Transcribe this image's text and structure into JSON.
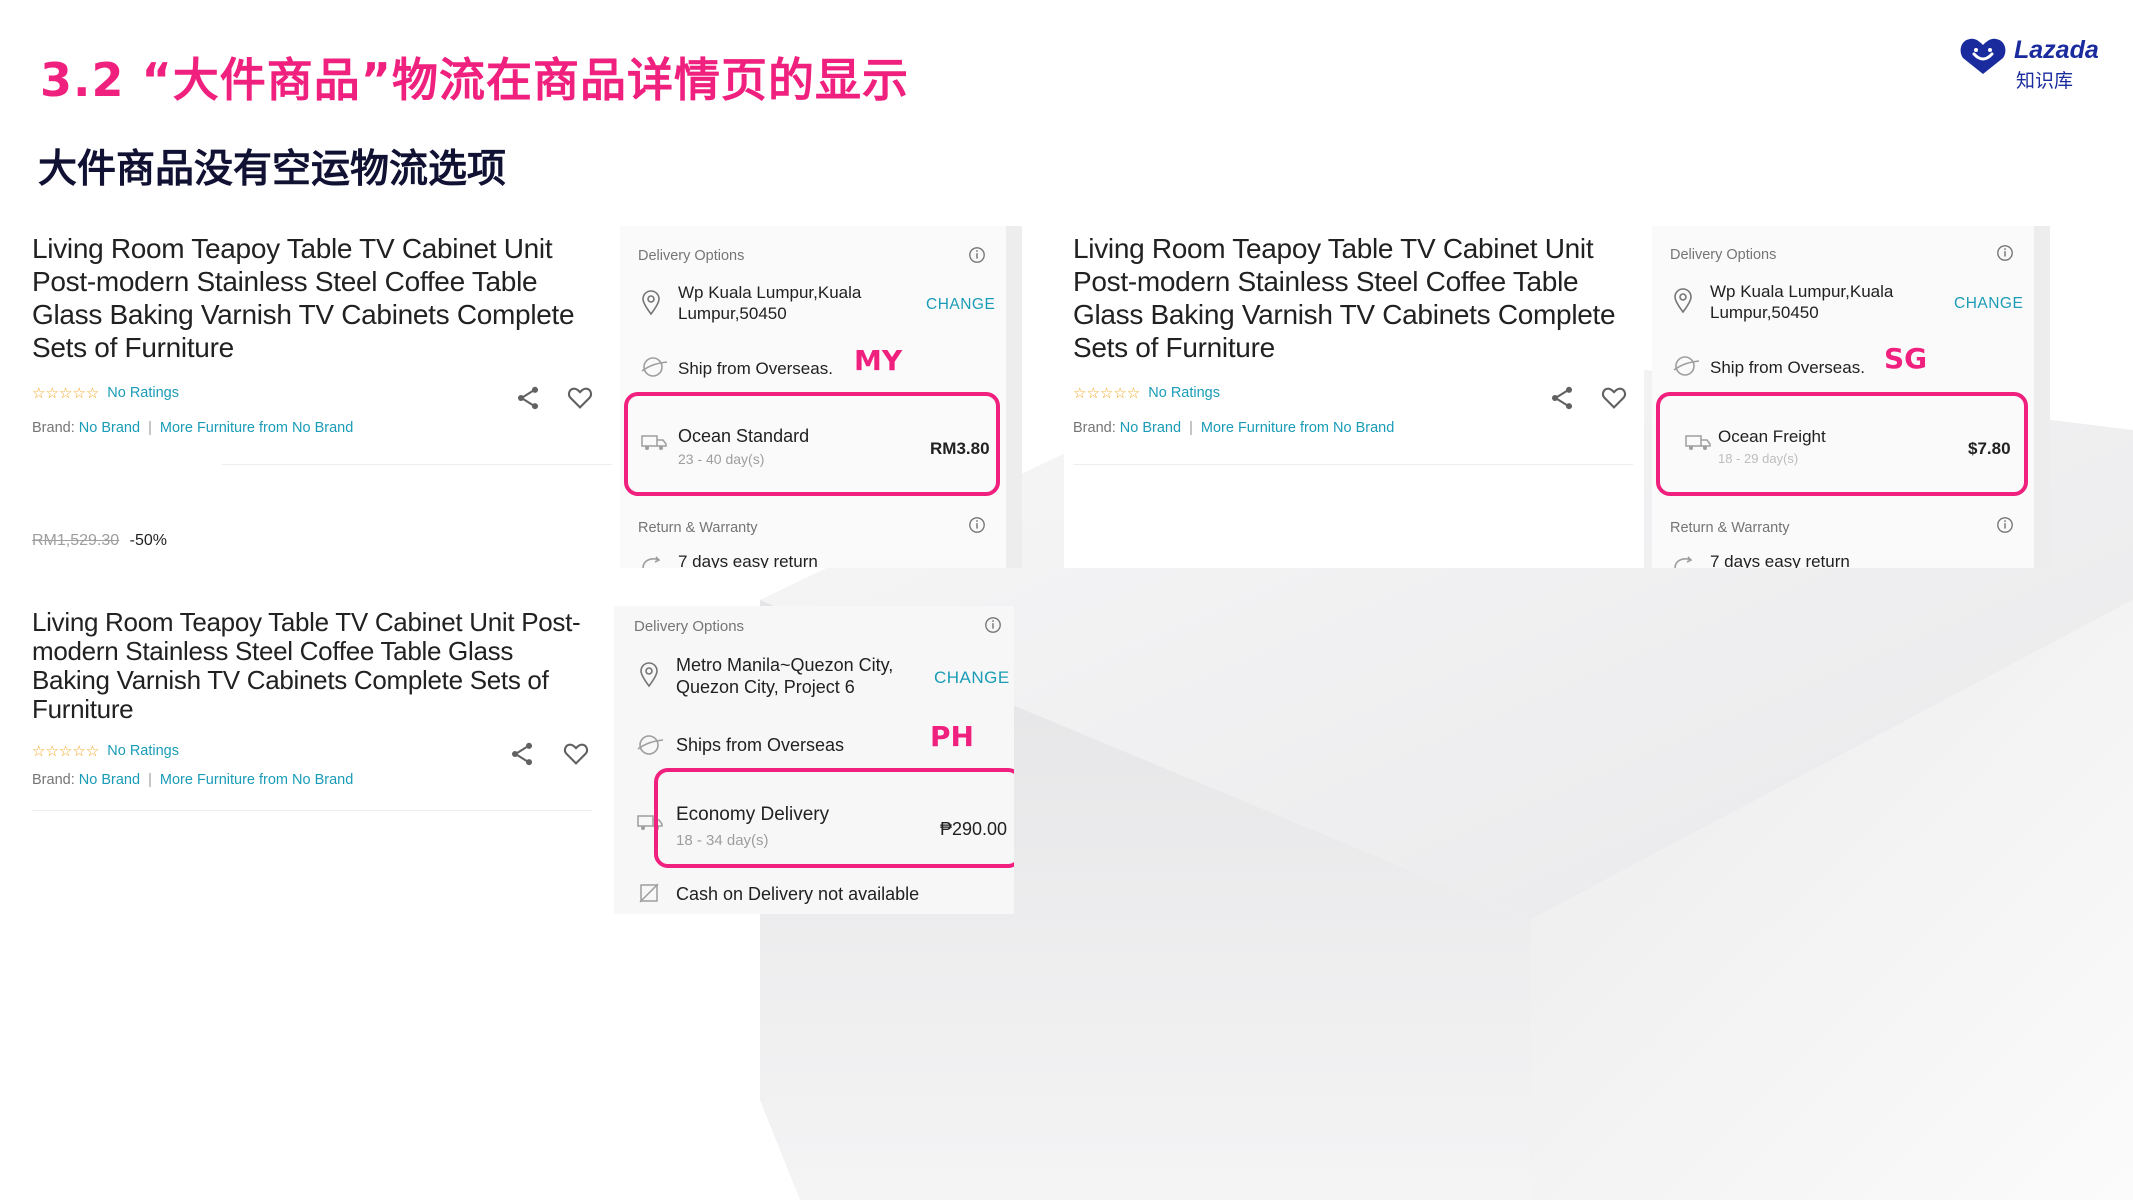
{
  "slide": {
    "title": "3.2 “大件商品”物流在商品详情页的显示",
    "subtitle": "大件商品没有空运物流选项"
  },
  "logo": {
    "wordmark": "Lazada",
    "sub": "知识库",
    "color": "#1a2b9e"
  },
  "accent_color": "#f0207e",
  "link_color": "#1a9cb7",
  "products": [
    {
      "title": "Living Room Teapoy Table TV Cabinet Unit Post-modern Stainless Steel Coffee Table Glass Baking Varnish TV Cabinets Complete Sets of Furniture",
      "stars": "☆☆☆☆☆",
      "no_ratings": "No Ratings",
      "brand_label": "Brand:",
      "brand": "No Brand",
      "sep": "|",
      "more": "More Furniture from No Brand",
      "old_price": "RM1,529.30",
      "discount": "-50%",
      "share_icon": "share-icon",
      "heart_icon": "heart-icon"
    },
    {
      "title": "Living Room Teapoy Table TV Cabinet Unit Post-modern Stainless Steel Coffee Table Glass Baking Varnish TV Cabinets Complete Sets of Furniture",
      "stars": "☆☆☆☆☆",
      "no_ratings": "No Ratings",
      "brand_label": "Brand:",
      "brand": "No Brand",
      "sep": "|",
      "more": "More Furniture from No Brand"
    },
    {
      "title": "Living Room Teapoy Table TV Cabinet Unit Post-modern Stainless Steel Coffee Table Glass Baking Varnish TV Cabinets Complete Sets of Furniture",
      "stars": "☆☆☆☆☆",
      "no_ratings": "No Ratings",
      "brand_label": "Brand:",
      "brand": "No Brand",
      "sep": "|",
      "more": "More Furniture from No Brand"
    }
  ],
  "panels": [
    {
      "country": "MY",
      "heading": "Delivery Options",
      "address": [
        "Wp Kuala Lumpur,Kuala",
        "Lumpur,50450"
      ],
      "change": "CHANGE",
      "ship_from": "Ship from Overseas.",
      "method": "Ocean Standard",
      "days": "23 - 40 day(s)",
      "fee": "RM3.80",
      "return_heading": "Return & Warranty",
      "return_text": "7 days easy return"
    },
    {
      "country": "SG",
      "heading": "Delivery Options",
      "address": [
        "Wp Kuala Lumpur,Kuala",
        "Lumpur,50450"
      ],
      "change": "CHANGE",
      "ship_from": "Ship from Overseas.",
      "method": "Ocean Freight",
      "days": "18 - 29 day(s)",
      "fee": "$7.80",
      "return_heading": "Return & Warranty",
      "return_text": "7 days easy return"
    },
    {
      "country": "PH",
      "heading": "Delivery Options",
      "address": [
        "Metro Manila~Quezon City,",
        "Quezon City, Project 6"
      ],
      "change": "CHANGE",
      "ship_from": "Ships from Overseas",
      "method": "Economy Delivery",
      "days": "18 - 34 day(s)",
      "fee": "₱290.00",
      "cod": "Cash on Delivery not available"
    }
  ]
}
